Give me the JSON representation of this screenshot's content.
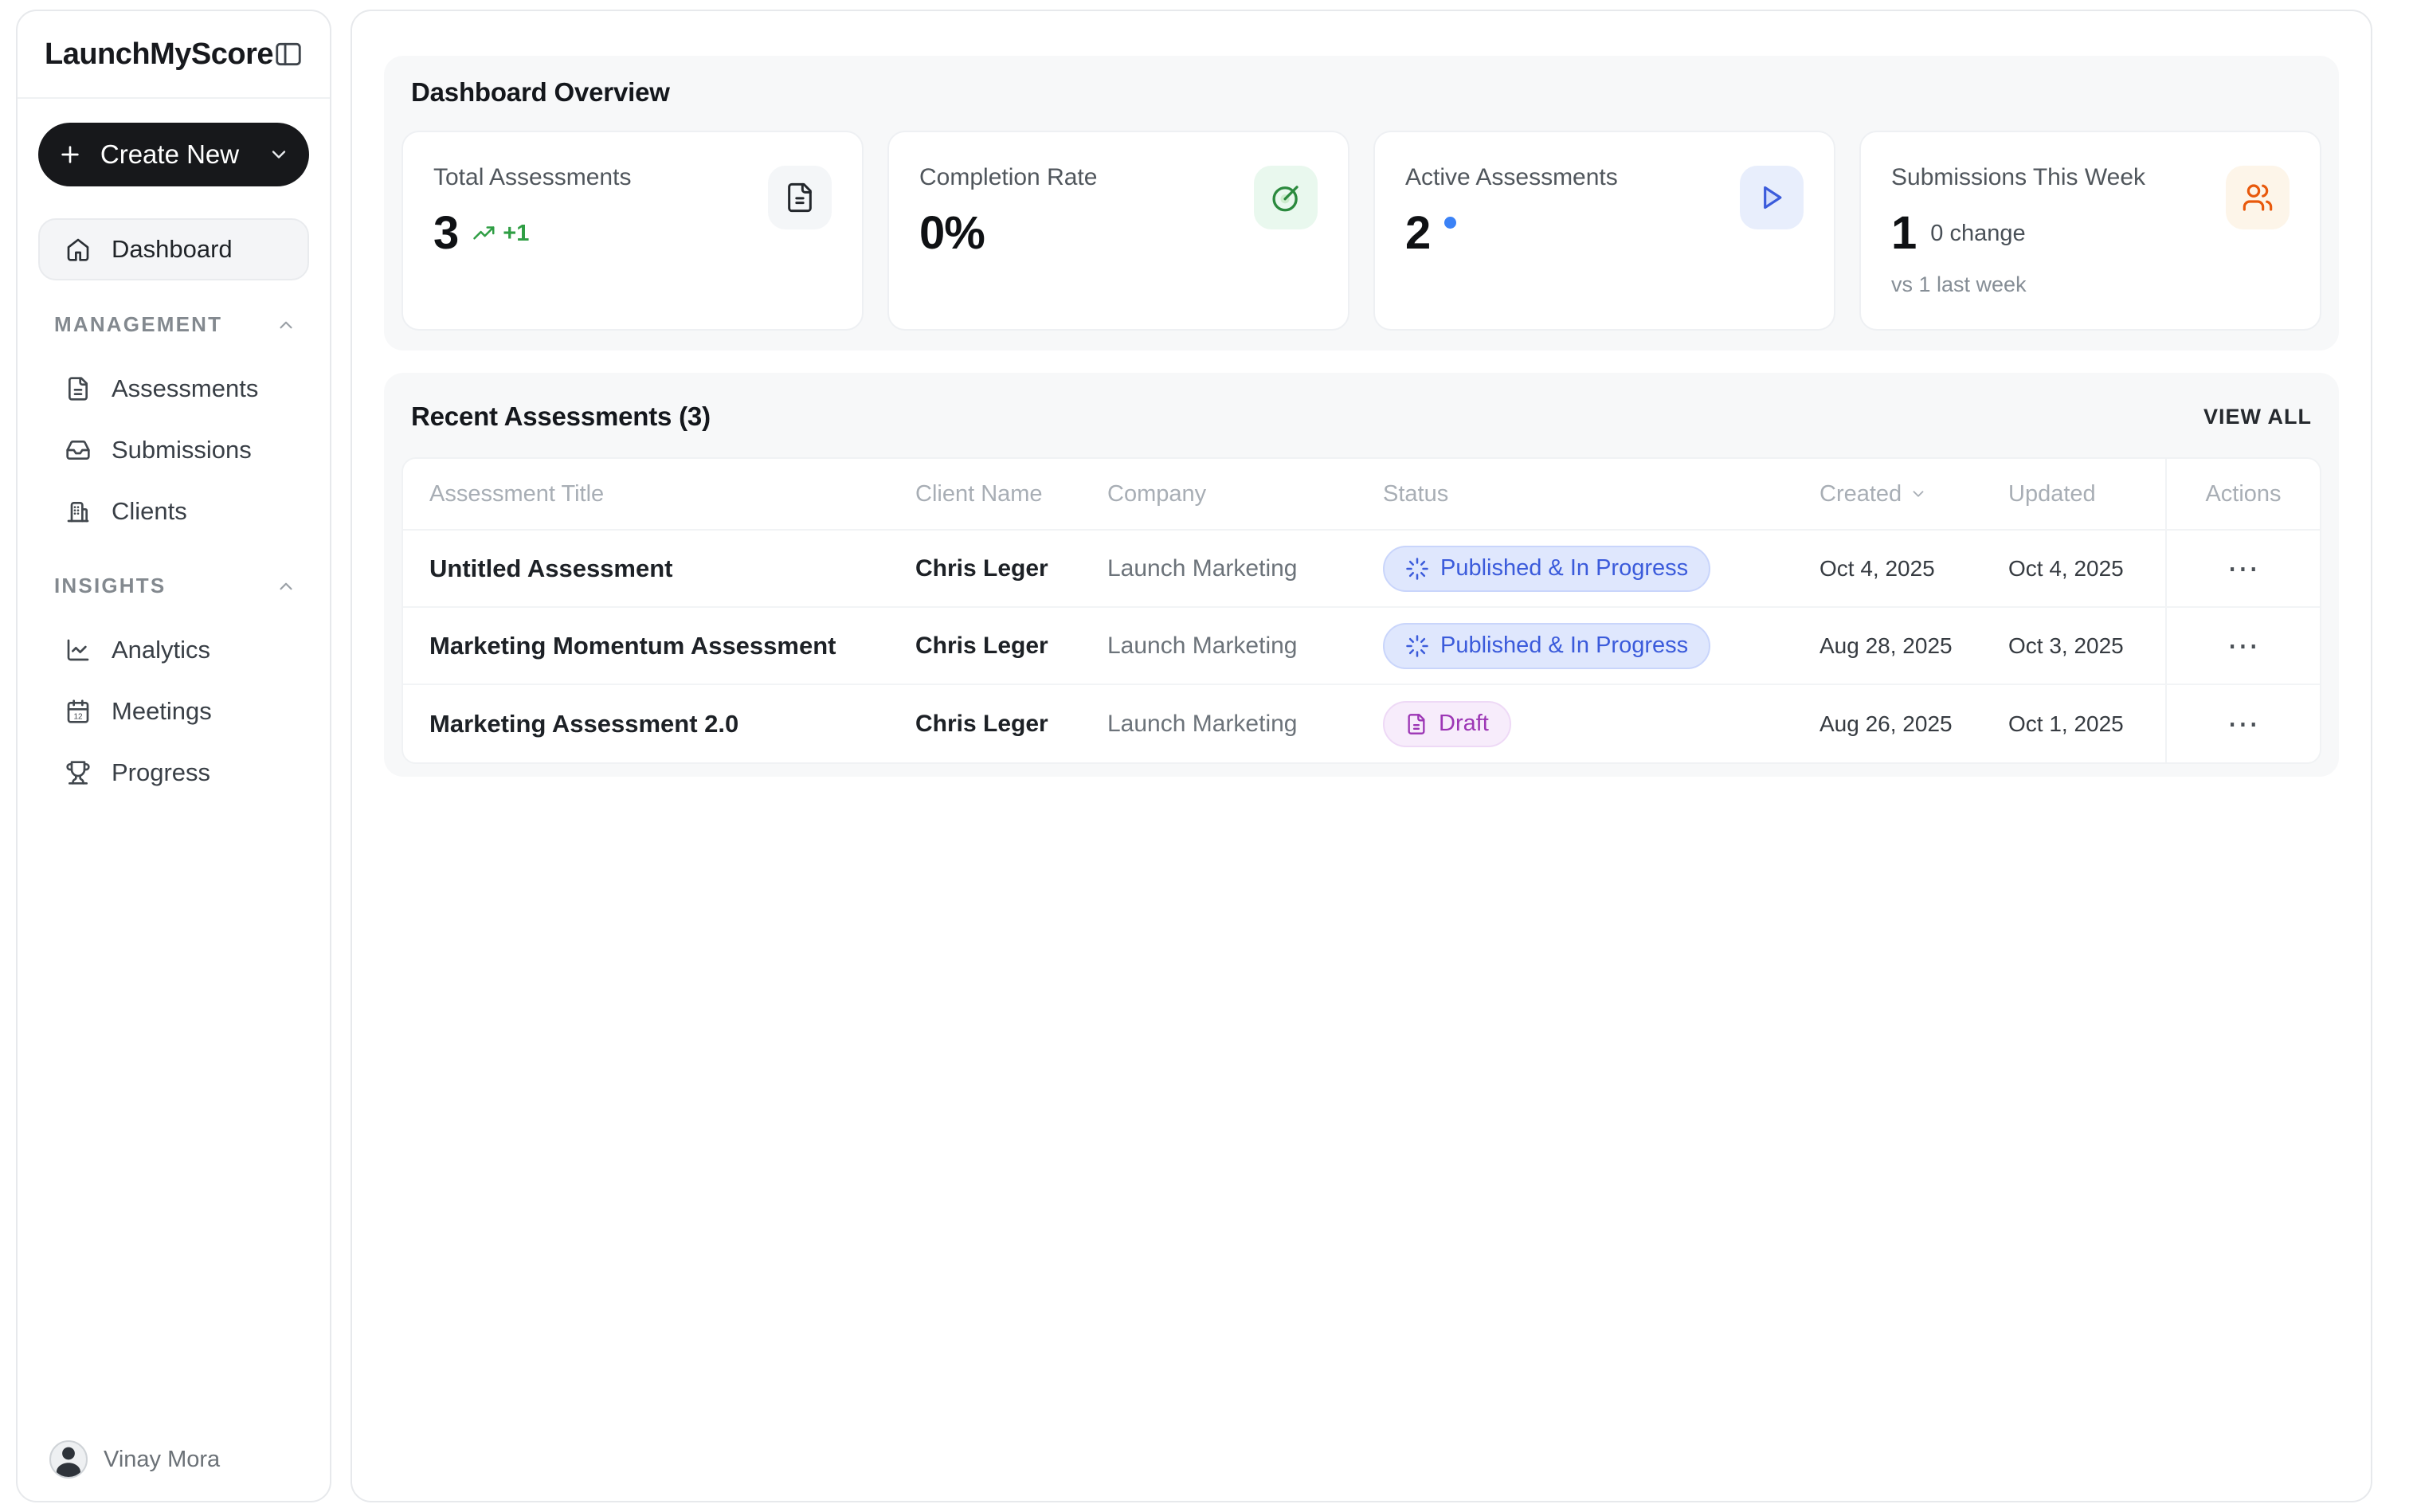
{
  "brand": {
    "name": "LaunchMyScore"
  },
  "sidebar": {
    "create_new": "Create New",
    "dashboard": "Dashboard",
    "sections": [
      {
        "label": "MANAGEMENT",
        "items": [
          {
            "label": "Assessments",
            "icon": "file-text-icon"
          },
          {
            "label": "Submissions",
            "icon": "inbox-icon"
          },
          {
            "label": "Clients",
            "icon": "building-icon"
          }
        ]
      },
      {
        "label": "INSIGHTS",
        "items": [
          {
            "label": "Analytics",
            "icon": "line-chart-icon"
          },
          {
            "label": "Meetings",
            "icon": "calendar-icon"
          },
          {
            "label": "Progress",
            "icon": "trophy-icon"
          }
        ]
      }
    ],
    "user": {
      "name": "Vinay Mora"
    }
  },
  "overview": {
    "title": "Dashboard Overview",
    "cards": [
      {
        "label": "Total Assessments",
        "value": "3",
        "delta": "+1",
        "icon": "document-icon"
      },
      {
        "label": "Completion Rate",
        "value": "0%",
        "icon": "goal-icon"
      },
      {
        "label": "Active Assessments",
        "value": "2",
        "icon": "play-icon"
      },
      {
        "label": "Submissions This Week",
        "value": "1",
        "change": "0 change",
        "comparison": "vs 1 last week",
        "icon": "users-icon"
      }
    ]
  },
  "recent": {
    "title": "Recent Assessments (3)",
    "view_all": "VIEW ALL",
    "columns": {
      "title": "Assessment Title",
      "client": "Client Name",
      "company": "Company",
      "status": "Status",
      "created": "Created",
      "updated": "Updated",
      "actions": "Actions"
    },
    "rows": [
      {
        "title": "Untitled Assessment",
        "client": "Chris Leger",
        "company": "Launch Marketing",
        "status": "Published & In Progress",
        "created": "Oct 4, 2025",
        "updated": "Oct 4, 2025"
      },
      {
        "title": "Marketing Momentum Assessment",
        "client": "Chris Leger",
        "company": "Launch Marketing",
        "status": "Published & In Progress",
        "created": "Aug 28, 2025",
        "updated": "Oct 3, 2025"
      },
      {
        "title": "Marketing Assessment 2.0",
        "client": "Chris Leger",
        "company": "Launch Marketing",
        "status": "Draft",
        "created": "Aug 26, 2025",
        "updated": "Oct 1, 2025"
      }
    ]
  },
  "icons": {
    "actions_glyph": "⋯"
  },
  "colors": {
    "positive": "#2f9e44",
    "active_dot": "#3b82f6",
    "published_text": "#3b5bdb",
    "published_bg": "#dfe7fd",
    "draft_text": "#9c36b5",
    "draft_bg": "#f7ecfb",
    "play_accent": "#3b5bdb",
    "users_accent": "#e8590c",
    "goal_accent": "#2b8a3e"
  }
}
